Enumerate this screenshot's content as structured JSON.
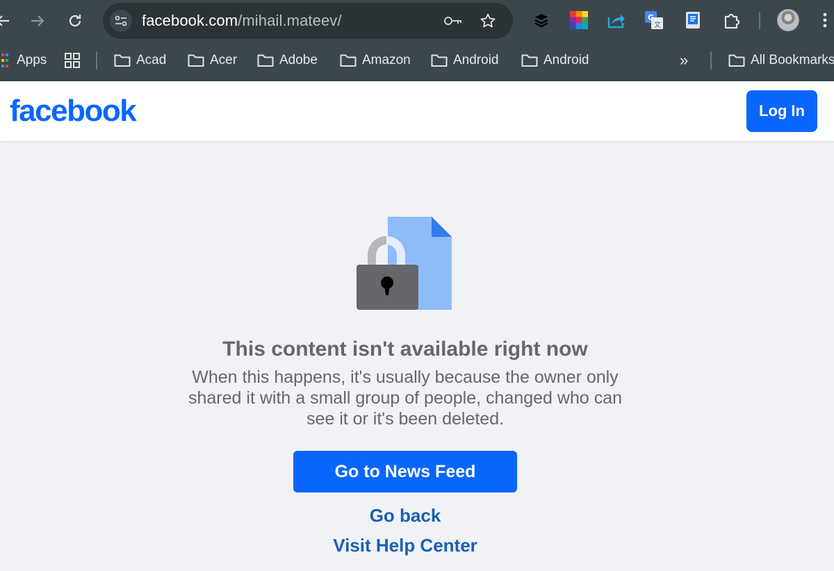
{
  "browser": {
    "url_host": "facebook.com",
    "url_path": "/mihail.mateev/",
    "bookmarks": [
      "Apps",
      "Acad",
      "Acer",
      "Adobe",
      "Amazon",
      "Android",
      "Android",
      "All Bookmarks"
    ],
    "more_glyph": "»"
  },
  "header": {
    "logo": "facebook",
    "login_label": "Log In"
  },
  "message": {
    "title": "This content isn't available right now",
    "description": "When this happens, it's usually because the owner only shared it with a small group of people, changed who can see it or it's been deleted."
  },
  "actions": {
    "primary_label": "Go to News Feed",
    "back_label": "Go back",
    "help_label": "Visit Help Center"
  },
  "colors": {
    "brand": "#0866ff",
    "link": "#1a5fb4",
    "text_muted": "#65676b",
    "page_bg": "#f0f2f5",
    "chrome_bg": "#3c474d"
  }
}
